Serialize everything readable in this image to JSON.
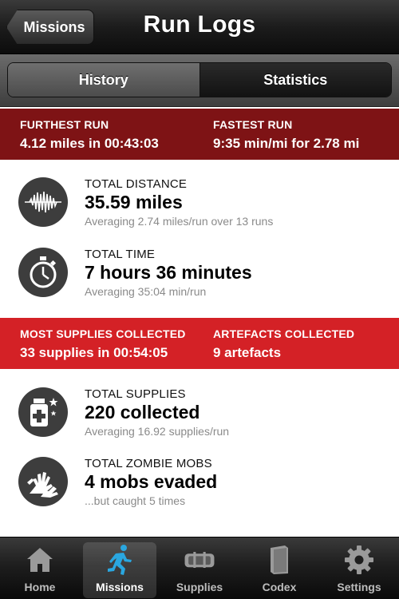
{
  "nav": {
    "title": "Run Logs",
    "back_label": "Missions"
  },
  "segments": {
    "history": "History",
    "statistics": "Statistics",
    "selected": "Statistics"
  },
  "highlights_top": {
    "left": {
      "caption": "FURTHEST RUN",
      "value": "4.12 miles in 00:43:03"
    },
    "right": {
      "caption": "FASTEST RUN",
      "value": "9:35 min/mi for 2.78 mi"
    }
  },
  "highlights_bottom": {
    "left": {
      "caption": "MOST SUPPLIES COLLECTED",
      "value": "33 supplies in 00:54:05"
    },
    "right": {
      "caption": "ARTEFACTS COLLECTED",
      "value": "9 artefacts"
    }
  },
  "stats": {
    "distance": {
      "label": "TOTAL DISTANCE",
      "value": "35.59 miles",
      "sub": "Averaging 2.74 miles/run over 13 runs",
      "icon": "waveform-icon"
    },
    "time": {
      "label": "TOTAL TIME",
      "value": "7 hours 36 minutes",
      "sub": "Averaging 35:04 min/run",
      "icon": "stopwatch-icon"
    },
    "supplies": {
      "label": "TOTAL SUPPLIES",
      "value": "220 collected",
      "sub": "Averaging 16.92 supplies/run",
      "icon": "medicine-bottle-icon"
    },
    "mobs": {
      "label": "TOTAL ZOMBIE MOBS",
      "value": "4 mobs evaded",
      "sub": "...but caught 5 times",
      "icon": "zombie-hands-icon"
    }
  },
  "colors": {
    "band_dark": "#7e1315",
    "band_red": "#d42126",
    "active_tab_icon": "#2aa7e0"
  },
  "tabs": [
    {
      "label": "Home",
      "icon": "house-icon"
    },
    {
      "label": "Missions",
      "icon": "runner-icon",
      "active": true
    },
    {
      "label": "Supplies",
      "icon": "case-icon"
    },
    {
      "label": "Codex",
      "icon": "book-icon"
    },
    {
      "label": "Settings",
      "icon": "gear-icon"
    }
  ]
}
